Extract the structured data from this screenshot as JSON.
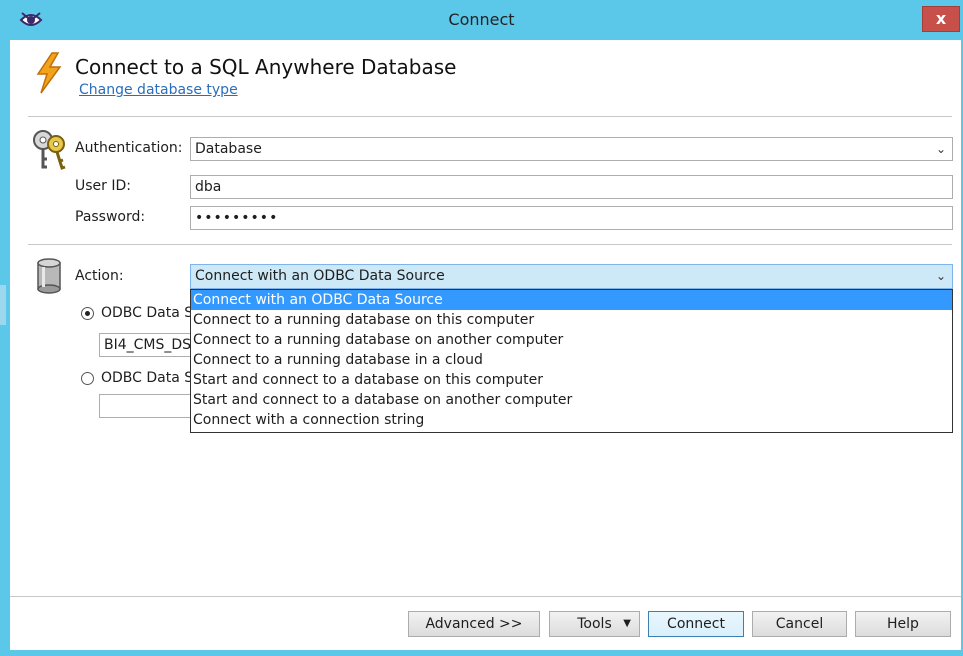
{
  "window": {
    "title": "Connect",
    "close_glyph": "x",
    "app_icon": "sybase-eye-icon"
  },
  "header": {
    "heading": "Connect to a SQL Anywhere Database",
    "change_link": "Change database type"
  },
  "auth": {
    "authentication_label": "Authentication:",
    "authentication_value": "Database",
    "userid_label": "User ID:",
    "userid_value": "dba",
    "password_label": "Password:",
    "password_value": "•••••••••"
  },
  "action": {
    "label": "Action:",
    "selected": "Connect with an ODBC Data Source",
    "options": [
      "Connect with an ODBC Data Source",
      "Connect to a running database on this computer",
      "Connect to a running database on another computer",
      "Connect to a running database in a cloud",
      "Start and connect to a database on this computer",
      "Start and connect to a database on another computer",
      "Connect with a connection string"
    ]
  },
  "odbc": {
    "radio1_label": "ODBC Data So",
    "radio1_value": "BI4_CMS_DS",
    "radio2_label": "ODBC Data So",
    "radio2_value": ""
  },
  "buttons": {
    "advanced": "Advanced >>",
    "tools": "Tools",
    "connect": "Connect",
    "cancel": "Cancel",
    "help": "Help"
  },
  "colors": {
    "titlebar": "#5bc8ea",
    "selection": "#3399ff",
    "link": "#2a6ebb",
    "close": "#c7504a"
  }
}
